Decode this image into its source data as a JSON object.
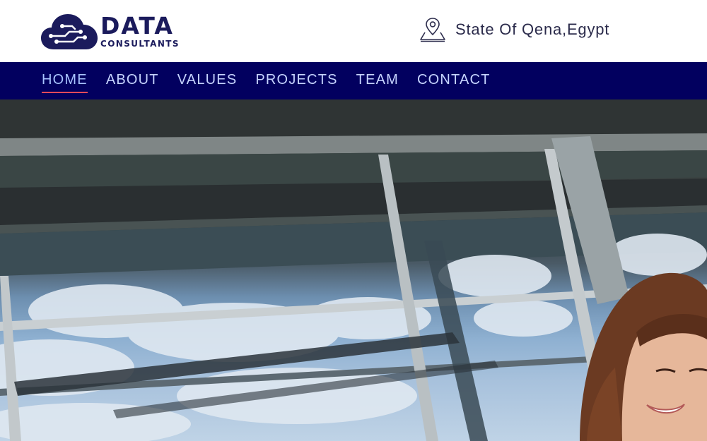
{
  "logo": {
    "word": "DATA",
    "sub": "CONSULTANTS",
    "icon": "cloud-circuit-icon",
    "color": "#1b1b5c"
  },
  "location": {
    "icon": "map-pin-icon",
    "text": "State Of Qena,Egypt"
  },
  "nav": {
    "background": "#02005f",
    "active_underline": "#e24a5a",
    "items": [
      {
        "label": "HOME",
        "active": true
      },
      {
        "label": "ABOUT",
        "active": false
      },
      {
        "label": "VALUES",
        "active": false
      },
      {
        "label": "PROJECTS",
        "active": false
      },
      {
        "label": "TEAM",
        "active": false
      },
      {
        "label": "CONTACT",
        "active": false
      }
    ]
  },
  "hero": {
    "image": "office-building-windows-with-smiling-woman"
  }
}
